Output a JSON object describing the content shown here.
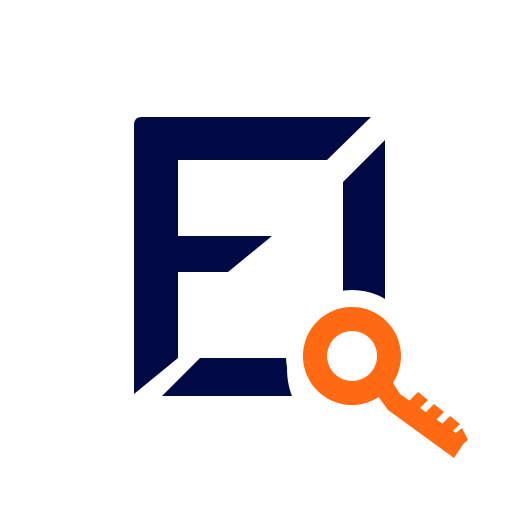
{
  "logo": {
    "name": "app-logo-with-key",
    "colors": {
      "background": "#ffffff",
      "mark": "#020a45",
      "key": "#ff6a13",
      "cutout": "#ffffff"
    },
    "icons": [
      "letter-e-square-icon",
      "key-icon"
    ]
  }
}
